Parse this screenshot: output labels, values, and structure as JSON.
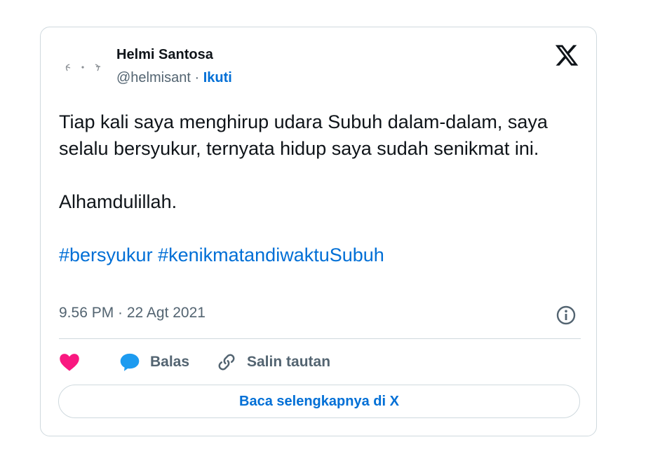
{
  "author": {
    "name": "Helmi Santosa",
    "handle": "@helmisant",
    "separator": " · ",
    "follow_label": "Ikuti"
  },
  "tweet": {
    "paragraphs": [
      "Tiap kali saya menghirup udara Subuh dalam-dalam, saya selalu bersyukur, ternyata hidup saya sudah senikmat ini.",
      "Alhamdulillah."
    ],
    "hashtags": [
      "#bersyukur",
      "#kenikmatandiwaktuSubuh"
    ],
    "timestamp": "9.56 PM · 22 Agt 2021"
  },
  "actions": {
    "like_icon": "heart-icon",
    "reply_label": "Balas",
    "reply_icon": "speech-bubble-icon",
    "copy_label": "Salin tautan",
    "copy_icon": "link-icon"
  },
  "read_more_label": "Baca selengkapnya di X",
  "colors": {
    "accent": "#006fd6",
    "like": "#f91880",
    "reply": "#1d9bf0",
    "text": "#0f1419",
    "muted": "#536471",
    "border": "#cfd9de"
  }
}
